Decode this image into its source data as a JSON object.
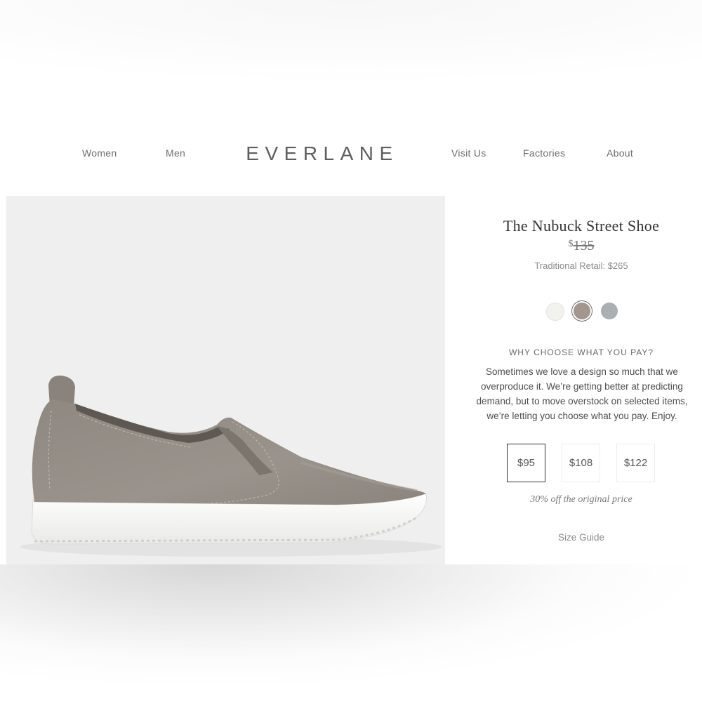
{
  "nav": {
    "left": [
      "Women",
      "Men"
    ],
    "right": [
      "Visit Us",
      "Factories",
      "About"
    ],
    "logo": "EVERLANE"
  },
  "product": {
    "title": "The Nubuck Street Shoe",
    "currency_symbol": "$",
    "original_price": "135",
    "traditional_retail": "Traditional Retail: $265",
    "swatches": [
      {
        "color": "#f2f2ef",
        "selected": false
      },
      {
        "color": "#a2968e",
        "selected": true
      },
      {
        "color": "#a9afb3",
        "selected": false
      }
    ],
    "why_heading": "WHY CHOOSE WHAT YOU PAY?",
    "why_text": "Sometimes we love a design so much that we overproduce it. We’re getting better at predicting demand, but to move overstock on selected items, we’re letting you choose what you pay. Enjoy.",
    "price_options": [
      "$95",
      "$108",
      "$122"
    ],
    "selected_price_index": 0,
    "discount_note": "30% off the original price",
    "size_guide": "Size Guide"
  },
  "colors": {
    "shoe_upper": "#928b84",
    "sole": "#f7f7f5",
    "panel_bg": "#efefef"
  }
}
